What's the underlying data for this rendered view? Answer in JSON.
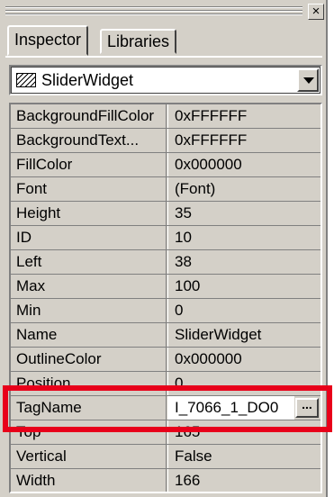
{
  "window": {
    "close_glyph": "×"
  },
  "tabs": [
    {
      "label": "Inspector",
      "active": true
    },
    {
      "label": "Libraries",
      "active": false
    }
  ],
  "selector": {
    "value": "SliderWidget",
    "icon": "slider-widget-icon"
  },
  "properties": [
    {
      "name": "BackgroundFillColor",
      "value": "0xFFFFFF"
    },
    {
      "name": "BackgroundText...",
      "value": "0xFFFFFF"
    },
    {
      "name": "FillColor",
      "value": "0x000000"
    },
    {
      "name": "Font",
      "value": "(Font)"
    },
    {
      "name": "Height",
      "value": "35"
    },
    {
      "name": "ID",
      "value": "10"
    },
    {
      "name": "Left",
      "value": "38"
    },
    {
      "name": "Max",
      "value": "100"
    },
    {
      "name": "Min",
      "value": "0"
    },
    {
      "name": "Name",
      "value": "SliderWidget"
    },
    {
      "name": "OutlineColor",
      "value": "0x000000"
    },
    {
      "name": "Position",
      "value": "0"
    },
    {
      "name": "TagName",
      "value": "I_7066_1_DO0",
      "selected": true,
      "button": "..."
    },
    {
      "name": "Top",
      "value": "165"
    },
    {
      "name": "Vertical",
      "value": "False"
    },
    {
      "name": "Width",
      "value": "166"
    }
  ],
  "colors": {
    "panel": "#d4d0c8",
    "highlight": "#e8001a"
  }
}
